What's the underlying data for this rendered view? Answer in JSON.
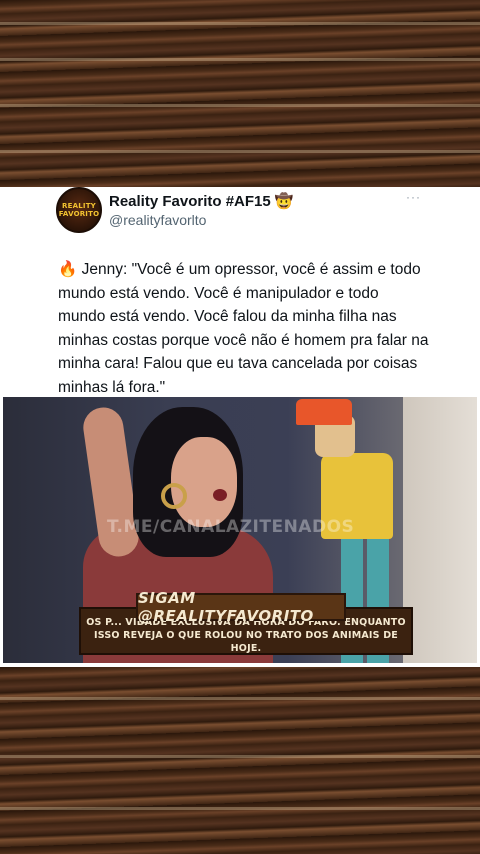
{
  "post": {
    "avatar_text_line1": "REALITY",
    "avatar_text_line2": "FAVORITO",
    "display_name": "Reality Favorito #AF15 🤠",
    "handle": "@realityfavorlto",
    "more": "···",
    "text_emoji": "🔥",
    "text": "Jenny: \"Você é um opressor, você é assim e todo mundo está vendo. Você é manipulador e todo mundo está vendo. Você falou da minha filha nas minhas costas porque você não é homem pra falar na minha cara! Falou que eu tava cancelada por coisas minhas lá fora.\""
  },
  "video": {
    "watermark": "T.ME/CANALAZITENADOS",
    "banner_top": "SIGAM @REALITYFAVORITO",
    "banner_bottom": "OS P... VIDADE EXCLUSIVA DA HORA DO FARO. ENQUANTO ISSO REVEJA O QUE ROLOU NO TRATO DOS ANIMAIS DE HOJE."
  }
}
